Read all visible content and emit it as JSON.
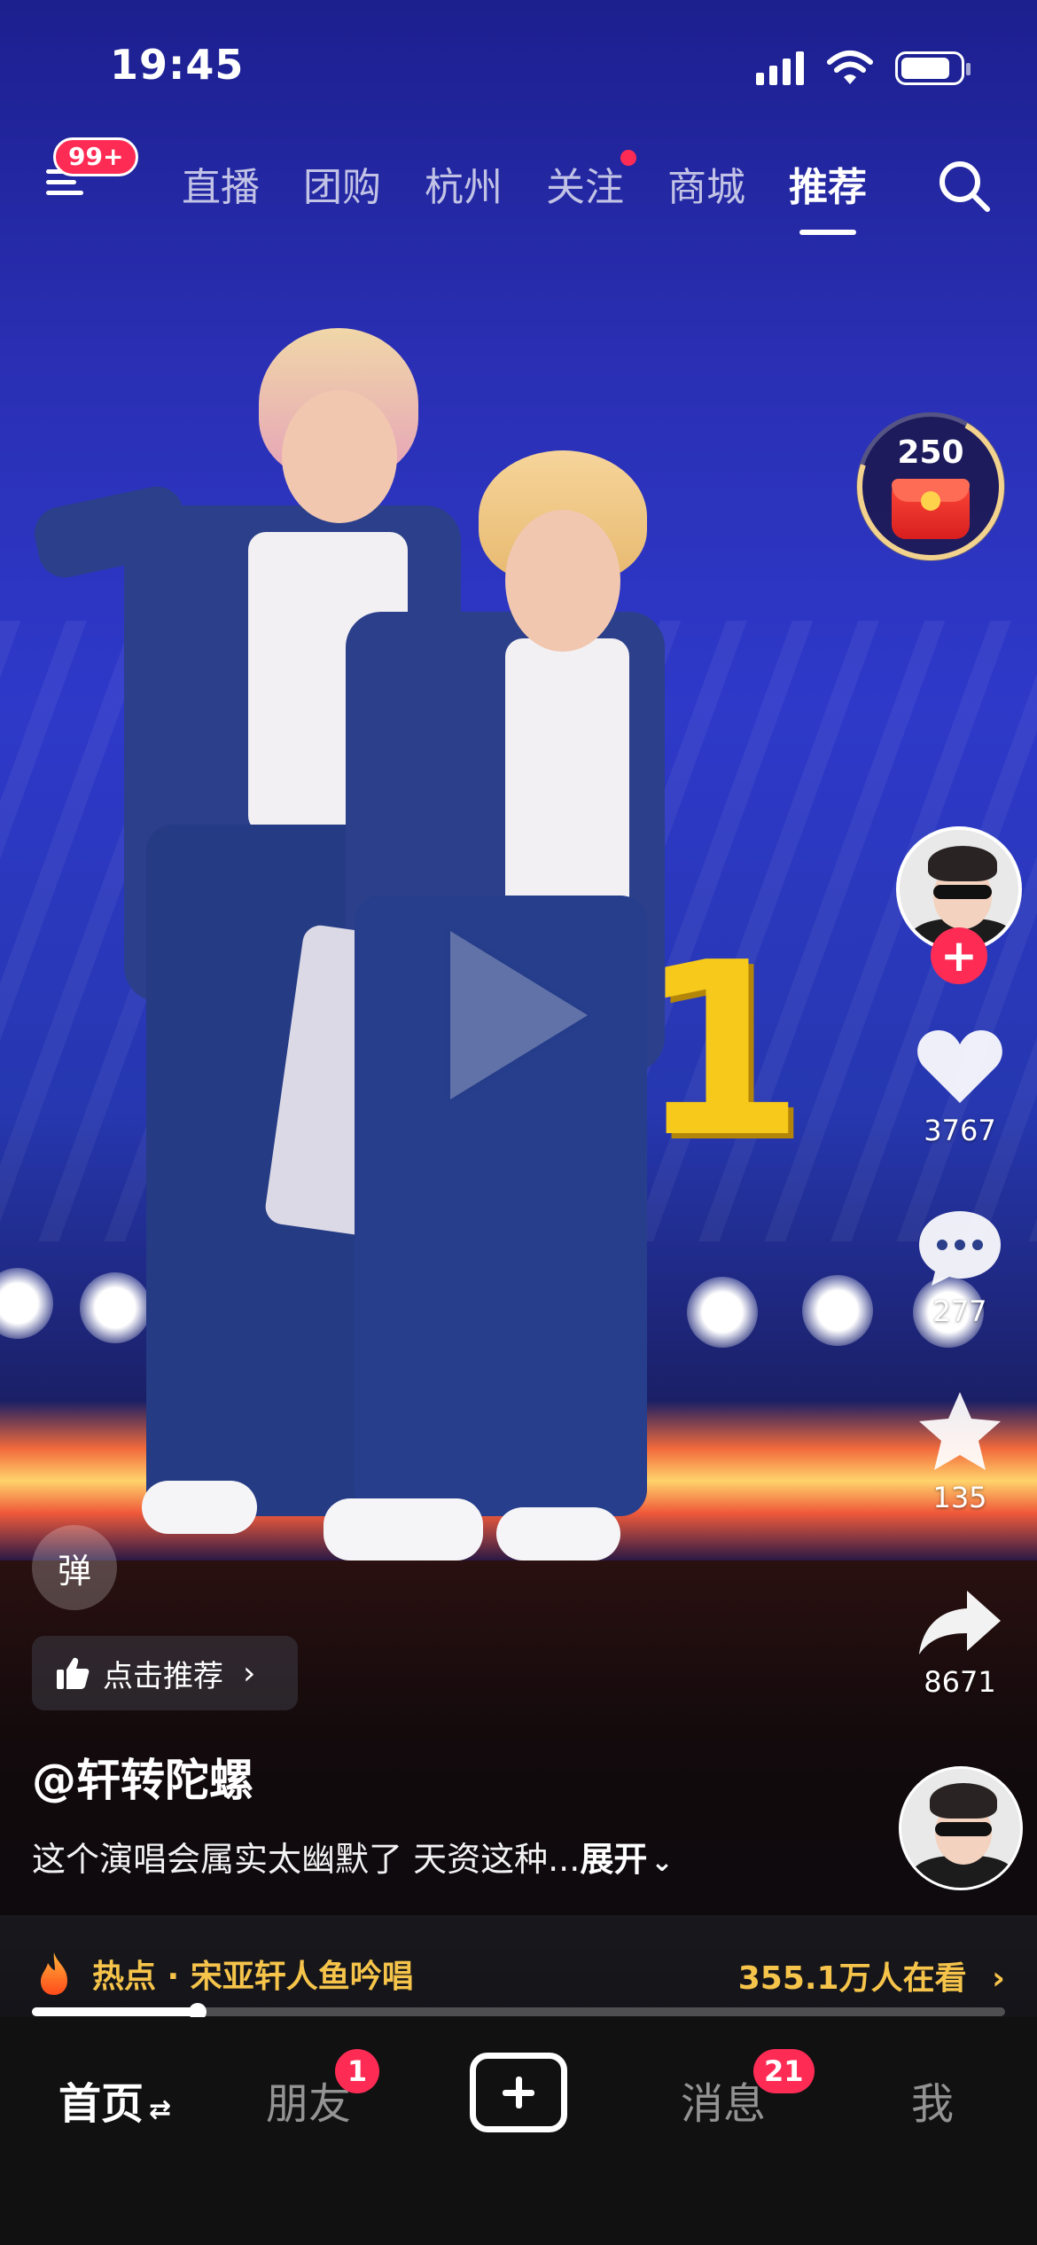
{
  "status_bar": {
    "time": "19:45"
  },
  "top_nav": {
    "menu_badge": "99+",
    "tabs": [
      {
        "label": "直播",
        "active": false,
        "dot": false
      },
      {
        "label": "团购",
        "active": false,
        "dot": false
      },
      {
        "label": "杭州",
        "active": false,
        "dot": false
      },
      {
        "label": "关注",
        "active": false,
        "dot": true
      },
      {
        "label": "商城",
        "active": false,
        "dot": false
      },
      {
        "label": "推荐",
        "active": true,
        "dot": false
      }
    ]
  },
  "video": {
    "overlay_number": "1",
    "playback": "paused"
  },
  "right_rail": {
    "red_packet_count": "250",
    "like_count": "3767",
    "comment_count": "277",
    "favorite_count": "135",
    "share_count": "8671"
  },
  "overlay": {
    "danmu_label": "弹",
    "recommend_label": "点击推荐",
    "author": "@轩转陀螺",
    "caption_text": "这个演唱会属实太幽默了 天资这种...",
    "expand_label": "展开"
  },
  "hot_bar": {
    "topic": "热点 · 宋亚轩人鱼吟唱",
    "viewers": "355.1万人在看"
  },
  "progress": {
    "fraction": 0.17
  },
  "tab_bar": {
    "home": "首页",
    "friends": "朋友",
    "friends_badge": "1",
    "messages": "消息",
    "messages_badge": "21",
    "me": "我"
  },
  "colors": {
    "accent": "#fe2c55",
    "hot_text": "#f6c44a",
    "overlay_number": "#f6c91b"
  },
  "icons": [
    "menu-icon",
    "search-icon",
    "red-packet-icon",
    "heart-icon",
    "comment-icon",
    "star-icon",
    "share-icon",
    "thumbs-up-icon",
    "flame-icon",
    "plus-icon",
    "chevron-right-icon",
    "chevron-down-icon"
  ]
}
